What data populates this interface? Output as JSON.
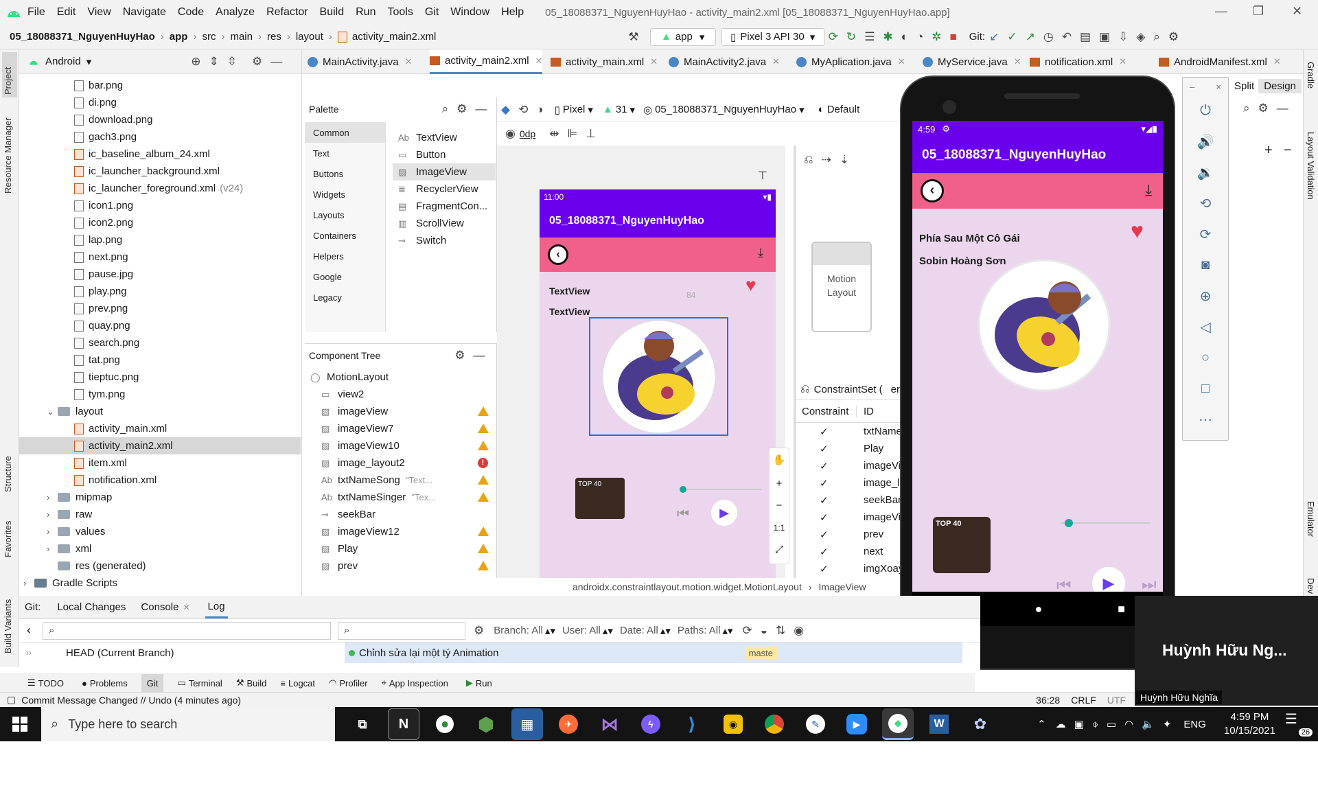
{
  "menu": {
    "items": [
      "File",
      "Edit",
      "View",
      "Navigate",
      "Code",
      "Analyze",
      "Refactor",
      "Build",
      "Run",
      "Tools",
      "Git",
      "Window",
      "Help"
    ],
    "title": "05_18088371_NguyenHuyHao - activity_main2.xml [05_18088371_NguyenHuyHao.app]"
  },
  "nav": {
    "breadcrumb": [
      "05_18088371_NguyenHuyHao",
      "app",
      "src",
      "main",
      "res",
      "layout",
      "activity_main2.xml"
    ],
    "run_config": "app",
    "device": "Pixel 3 API 30",
    "git_label": "Git:"
  },
  "project": {
    "view": "Android",
    "items": [
      {
        "label": "bar.png",
        "type": "png",
        "indent": 1
      },
      {
        "label": "di.png",
        "type": "png",
        "indent": 1
      },
      {
        "label": "download.png",
        "type": "png",
        "indent": 1
      },
      {
        "label": "gach3.png",
        "type": "png",
        "indent": 1
      },
      {
        "label": "ic_baseline_album_24.xml",
        "type": "xml",
        "indent": 1
      },
      {
        "label": "ic_launcher_background.xml",
        "type": "xml",
        "indent": 1
      },
      {
        "label": "ic_launcher_foreground.xml",
        "type": "xml",
        "indent": 1,
        "suffix": "(v24)"
      },
      {
        "label": "icon1.png",
        "type": "png",
        "indent": 1
      },
      {
        "label": "icon2.png",
        "type": "png",
        "indent": 1
      },
      {
        "label": "lap.png",
        "type": "png",
        "indent": 1
      },
      {
        "label": "next.png",
        "type": "png",
        "indent": 1
      },
      {
        "label": "pause.jpg",
        "type": "png",
        "indent": 1
      },
      {
        "label": "play.png",
        "type": "png",
        "indent": 1
      },
      {
        "label": "prev.png",
        "type": "png",
        "indent": 1
      },
      {
        "label": "quay.png",
        "type": "png",
        "indent": 1
      },
      {
        "label": "search.png",
        "type": "png",
        "indent": 1
      },
      {
        "label": "tat.png",
        "type": "png",
        "indent": 1
      },
      {
        "label": "tieptuc.png",
        "type": "png",
        "indent": 1
      },
      {
        "label": "tym.png",
        "type": "png",
        "indent": 1
      },
      {
        "label": "layout",
        "type": "folder-open",
        "indent": 0
      },
      {
        "label": "activity_main.xml",
        "type": "xml",
        "indent": 1
      },
      {
        "label": "activity_main2.xml",
        "type": "xml",
        "indent": 1,
        "selected": true
      },
      {
        "label": "item.xml",
        "type": "xml",
        "indent": 1
      },
      {
        "label": "notification.xml",
        "type": "xml",
        "indent": 1
      },
      {
        "label": "mipmap",
        "type": "folder",
        "indent": 0
      },
      {
        "label": "raw",
        "type": "folder",
        "indent": 0
      },
      {
        "label": "values",
        "type": "folder",
        "indent": 0
      },
      {
        "label": "xml",
        "type": "folder",
        "indent": 0
      },
      {
        "label": "res (generated)",
        "type": "folder-plain",
        "indent": 0
      },
      {
        "label": "Gradle Scripts",
        "type": "gradle",
        "indent": -1
      }
    ]
  },
  "tabs": [
    {
      "label": "MainActivity.java",
      "kind": "java"
    },
    {
      "label": "activity_main2.xml",
      "kind": "xml",
      "active": true
    },
    {
      "label": "activity_main.xml",
      "kind": "xml"
    },
    {
      "label": "MainActivity2.java",
      "kind": "java"
    },
    {
      "label": "MyAplication.java",
      "kind": "java"
    },
    {
      "label": "MyService.java",
      "kind": "java"
    },
    {
      "label": "notification.xml",
      "kind": "xml"
    },
    {
      "label": "AndroidManifest.xml",
      "kind": "xml"
    }
  ],
  "design_mode": {
    "split": "Split",
    "design": "Design"
  },
  "palette": {
    "title": "Palette",
    "categories": [
      "Common",
      "Text",
      "Buttons",
      "Widgets",
      "Layouts",
      "Containers",
      "Helpers",
      "Google",
      "Legacy"
    ],
    "items": [
      "TextView",
      "Button",
      "ImageView",
      "RecyclerView",
      "FragmentCon...",
      "ScrollView",
      "Switch"
    ]
  },
  "component_tree": {
    "title": "Component Tree",
    "items": [
      {
        "label": "MotionLayout",
        "status": ""
      },
      {
        "label": "view2",
        "status": ""
      },
      {
        "label": "imageView",
        "status": "warn"
      },
      {
        "label": "imageView7",
        "status": "warn"
      },
      {
        "label": "imageView10",
        "status": "warn"
      },
      {
        "label": "image_layout2",
        "status": "error"
      },
      {
        "label": "txtNameSong",
        "hint": "\"Text...",
        "status": "warn"
      },
      {
        "label": "txtNameSinger",
        "hint": "\"Tex...",
        "status": "warn"
      },
      {
        "label": "seekBar",
        "status": ""
      },
      {
        "label": "imageView12",
        "status": "warn"
      },
      {
        "label": "Play",
        "status": "warn"
      },
      {
        "label": "prev",
        "status": "warn"
      }
    ]
  },
  "design_toolbar": {
    "device": "Pixel",
    "api": "31",
    "project": "05_18088371_NguyenHuyHao",
    "theme": "Default",
    "margin": "0dp"
  },
  "preview": {
    "time": "11:00",
    "app_title": "05_18088371_NguyenHuyHao",
    "text1": "TextView",
    "text2": "TextView",
    "margin_value": "84",
    "album_text": "TOP 40"
  },
  "motion_box": {
    "label": "Motion Layout"
  },
  "constraint_set": {
    "title": "ConstraintSet (",
    "title_cut": "er",
    "col_constraint": "Constraint",
    "col_id": "ID",
    "rows": [
      "txtNameS",
      "Play",
      "imageVie",
      "image_lay",
      "seekBar",
      "imageVie",
      "prev",
      "next",
      "imgXoay"
    ]
  },
  "breadcrumb_bottom": [
    "androidx.constraintlayout.motion.widget.MotionLayout",
    "ImageView"
  ],
  "emulator": {
    "time": "4:59",
    "app_title": "05_18088371_NguyenHuyHao",
    "song": "Phía Sau Một Cô Gái",
    "singer": "Sobin Hoàng Sơn",
    "album_text": "TOP 40",
    "seek_progress": 0.05
  },
  "git_panel": {
    "tabs": [
      "Git:",
      "Local Changes",
      "Console",
      "Log"
    ],
    "branch_filter": "Branch: All",
    "user_filter": "User: All",
    "date_filter": "Date: All",
    "paths_filter": "Paths: All",
    "head": "HEAD (Current Branch)",
    "commit": "Chỉnh sửa lại một tý Animation",
    "master": "maste"
  },
  "bottom_tools": [
    "TODO",
    "Problems",
    "Git",
    "Terminal",
    "Build",
    "Logcat",
    "Profiler",
    "App Inspection",
    "Run"
  ],
  "status": {
    "message": "Commit Message Changed // Undo (4 minutes ago)",
    "position": "36:28",
    "line_sep": "CRLF",
    "encoding": "UTF"
  },
  "overlay": {
    "name_big": "Huỳnh Hữu Ng...",
    "name_small": "Huỳnh Hữu Nghĩa"
  },
  "right_strip": [
    "Gradle",
    "Layout Validation",
    "Emulator",
    "Dev"
  ],
  "left_strip": [
    "Project",
    "Resource Manager",
    "Structure",
    "Favorites",
    "Build Variants"
  ],
  "taskbar": {
    "search": "Type here to search",
    "lang": "ENG",
    "time": "4:59 PM",
    "date": "10/15/2021",
    "notif": "26"
  }
}
